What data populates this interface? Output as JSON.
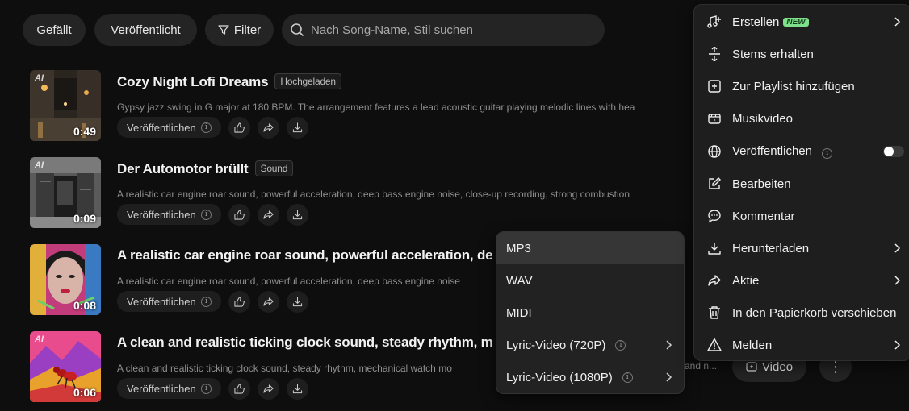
{
  "filters": {
    "liked": "Gefällt",
    "published": "Veröffentlicht",
    "filter": "Filter",
    "search_placeholder": "Nach Song-Name, Stil suchen"
  },
  "songs": [
    {
      "title": "Cozy Night Lofi Dreams",
      "tag": "Hochgeladen",
      "description": "Gypsy jazz swing in G major at 180 BPM. The arrangement features a lead acoustic guitar playing melodic lines with hea",
      "duration": "0:49",
      "ai_label": "AI",
      "publish_label": "Veröffentlichen"
    },
    {
      "title": "Der Automotor brüllt",
      "tag": "Sound",
      "description": "A realistic car engine roar sound, powerful acceleration, deep bass engine noise, close-up recording, strong combustion",
      "duration": "0:09",
      "ai_label": "AI",
      "publish_label": "Veröffentlichen"
    },
    {
      "title": "A realistic car engine roar sound, powerful acceleration, de",
      "tag": "",
      "description": "A realistic car engine roar sound, powerful acceleration, deep bass engine noise",
      "duration": "0:08",
      "ai_label": "",
      "publish_label": "Veröffentlichen"
    },
    {
      "title": "A clean and realistic ticking clock sound, steady rhythm, m",
      "tag": "",
      "description": "A clean and realistic ticking clock sound, steady rhythm, mechanical watch mo",
      "duration": "0:06",
      "ai_label": "AI",
      "publish_label": "Veröffentlichen"
    }
  ],
  "row4_right": {
    "desc_tail": "and n...",
    "video_label": "Video",
    "more_label": "⋮"
  },
  "context_menu": {
    "items": [
      {
        "label": "Erstellen",
        "badge": "NEW",
        "icon": "create-music-icon"
      },
      {
        "label": "Stems erhalten",
        "icon": "stems-icon"
      },
      {
        "label": "Zur Playlist hinzufügen",
        "icon": "playlist-add-icon"
      },
      {
        "label": "Musikvideo",
        "icon": "video-camera-icon"
      },
      {
        "label": "Veröffentlichen",
        "icon": "globe-icon",
        "toggle_on": false
      },
      {
        "label": "Bearbeiten",
        "icon": "edit-icon"
      },
      {
        "label": "Kommentar",
        "icon": "comment-icon"
      },
      {
        "label": "Herunterladen",
        "icon": "download-icon"
      },
      {
        "label": "Aktie",
        "icon": "share-icon"
      },
      {
        "label": "In den Papierkorb verschieben",
        "icon": "trash-icon"
      },
      {
        "label": "Melden",
        "icon": "warning-icon"
      }
    ]
  },
  "download_submenu": {
    "items": [
      {
        "label": "MP3",
        "highlighted": true
      },
      {
        "label": "WAV"
      },
      {
        "label": "MIDI"
      },
      {
        "label": "Lyric-Video (720P)",
        "info": true,
        "submenu": true
      },
      {
        "label": "Lyric-Video (1080P)",
        "info": true,
        "submenu": true
      }
    ]
  },
  "colors": {
    "background": "#0e0e0e",
    "menu_bg": "#1e1e1e",
    "new_badge": "#7ee08a"
  }
}
